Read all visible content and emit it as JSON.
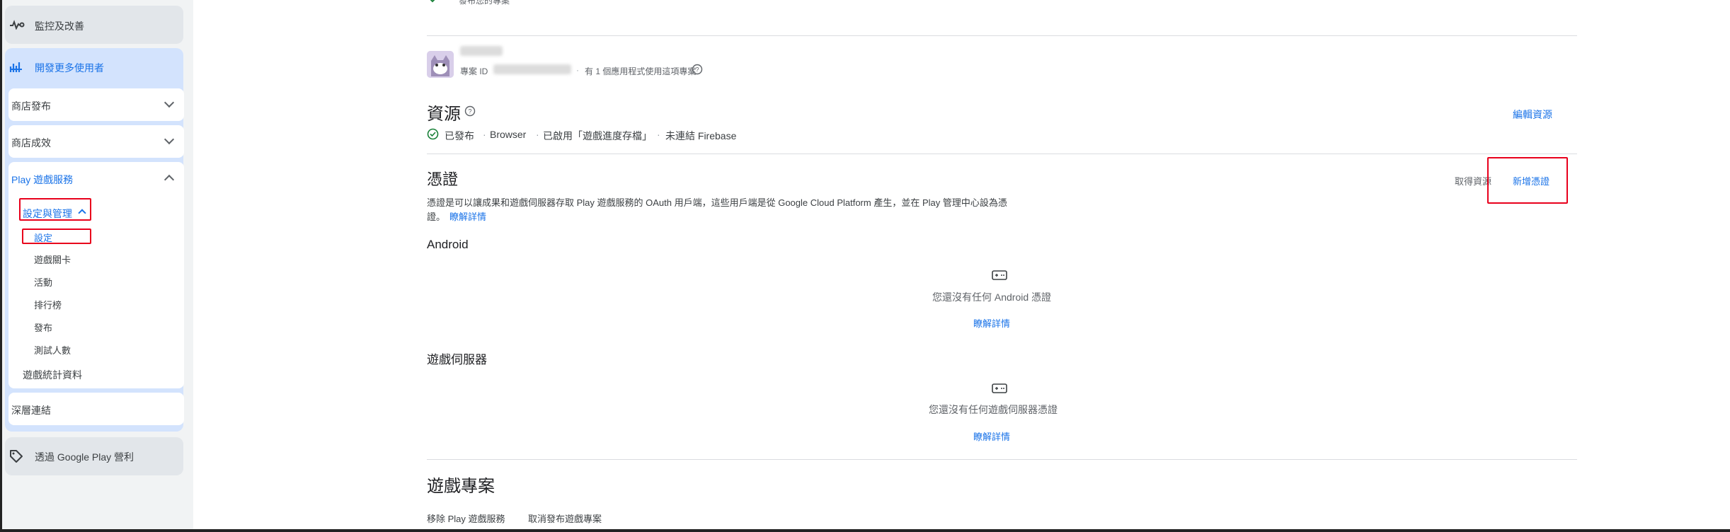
{
  "sidebar": {
    "monitor_label": "監控及改善",
    "grow_label": "開發更多使用者",
    "store_presence": "商店發布",
    "store_performance": "商店成效",
    "pgs_label": "Play 遊戲服務",
    "setup_label": "設定與管理",
    "sub_items": [
      "設定",
      "遊戲關卡",
      "活動",
      "排行榜",
      "發布",
      "測試人數"
    ],
    "game_stats": "遊戲統計資料",
    "deep_links": "深層連結",
    "monetize_label": "透過 Google Play 營利"
  },
  "main": {
    "top_partial_text": "發布您的專案",
    "project": {
      "id_label": "專案 ID",
      "apps_text": "有 1 個應用程式使用這項專案"
    },
    "resources": {
      "title": "資源",
      "edit_link": "編輯資源",
      "status": [
        "已發布",
        "Browser",
        "已啟用「遊戲進度存檔」",
        "未連結 Firebase"
      ]
    },
    "credentials": {
      "title": "憑證",
      "get_resources": "取得資源",
      "add_credential": "新增憑證",
      "description": "憑證是可以讓成果和遊戲伺服器存取 Play 遊戲服務的 OAuth 用戶端，這些用戶端是從 Google Cloud Platform 產生，並在 Play 管理中心設為憑",
      "description_cont": "證。",
      "learn_more": "瞭解詳情",
      "android": {
        "title": "Android",
        "empty": "您還沒有任何 Android 憑證",
        "learn_more": "瞭解詳情"
      },
      "server": {
        "title": "遊戲伺服器",
        "empty": "您還沒有任何遊戲伺服器憑證",
        "learn_more": "瞭解詳情"
      }
    },
    "game_project": {
      "title": "遊戲專案",
      "remove": "移除 Play 遊戲服務",
      "unpublish": "取消發布遊戲專案"
    }
  },
  "colors": {
    "link": "#1a73e8",
    "annotation": "#e8001c",
    "sidebar_bg": "#f1f3f4",
    "active_card": "#d3e3fd",
    "success": "#188038"
  }
}
